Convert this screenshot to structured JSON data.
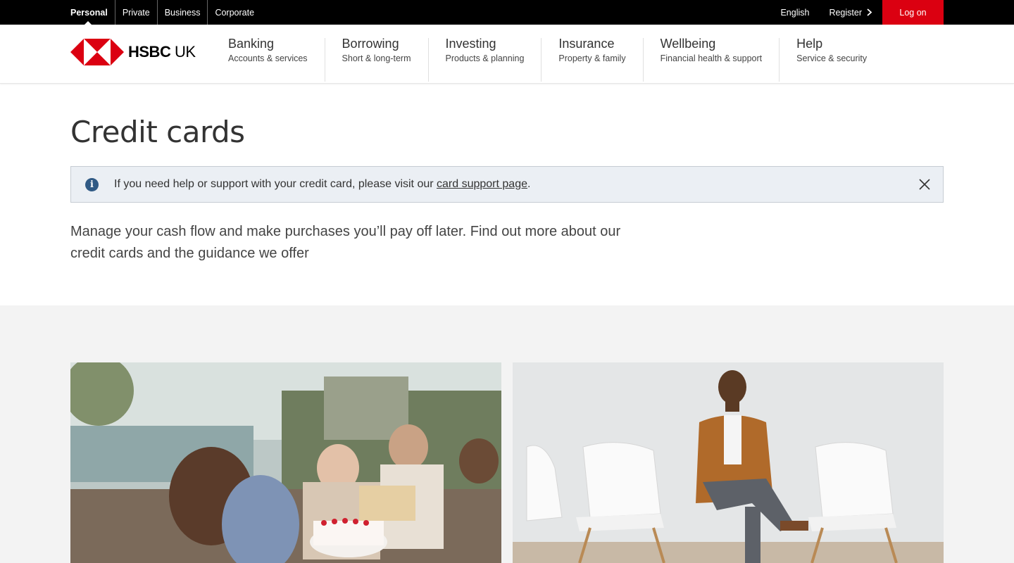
{
  "topbar": {
    "segments": [
      "Personal",
      "Private",
      "Business",
      "Corporate"
    ],
    "language": "English",
    "register": "Register",
    "logon": "Log on"
  },
  "brand": {
    "name": "HSBC",
    "region": "UK",
    "colors": {
      "primary": "#db0011",
      "black": "#000000"
    }
  },
  "nav": [
    {
      "title": "Banking",
      "subtitle": "Accounts & services"
    },
    {
      "title": "Borrowing",
      "subtitle": "Short & long-term"
    },
    {
      "title": "Investing",
      "subtitle": "Products & planning"
    },
    {
      "title": "Insurance",
      "subtitle": "Property & family"
    },
    {
      "title": "Wellbeing",
      "subtitle": "Financial health & support"
    },
    {
      "title": "Help",
      "subtitle": "Service & security"
    }
  ],
  "page": {
    "title": "Credit cards",
    "notice": {
      "text_before": "If you need help or support with your credit card, please visit our ",
      "link": "card support page",
      "text_after": "."
    },
    "intro": "Manage your cash flow and make purchases you’ll pay off later. Find out more about our credit cards and the guidance we offer"
  },
  "icons": {
    "info": "info-icon",
    "close": "close-icon",
    "register_chevron": "chevron-right-icon"
  }
}
